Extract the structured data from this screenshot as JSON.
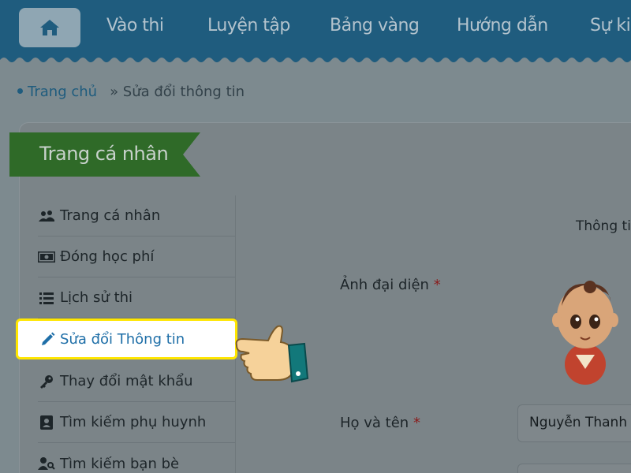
{
  "nav": {
    "items": [
      "Vào thi",
      "Luyện tập",
      "Bảng vàng",
      "Hướng dẫn",
      "Sự kiện"
    ]
  },
  "breadcrumb": {
    "home": "Trang chủ",
    "current": "» Sửa đổi thông tin"
  },
  "panel": {
    "title": "Trang cá nhân"
  },
  "sidebar": {
    "items": [
      {
        "label": "Trang cá nhân",
        "icon": "users-icon"
      },
      {
        "label": "Đóng học phí",
        "icon": "money-icon"
      },
      {
        "label": "Lịch sử thi",
        "icon": "list-icon"
      },
      {
        "label": "Sửa đổi Thông tin",
        "icon": "pencil-icon",
        "active": true
      },
      {
        "label": "Thay đổi mật khẩu",
        "icon": "key-icon"
      },
      {
        "label": "Tìm kiếm phụ huynh",
        "icon": "contact-card-icon"
      },
      {
        "label": "Tìm kiếm bạn bè",
        "icon": "user-search-icon"
      }
    ]
  },
  "form": {
    "section_heading": "Thông tin",
    "avatar_label": "Ảnh đại diện",
    "fullname_label": "Họ và tên",
    "required_mark": "*",
    "fullname_value": "Nguyễn Thanh Tâm"
  },
  "colors": {
    "nav_bg": "#1f5c7e",
    "ribbon": "#2f6a28",
    "active_border": "#ffe600",
    "active_text": "#1f6fa8"
  }
}
